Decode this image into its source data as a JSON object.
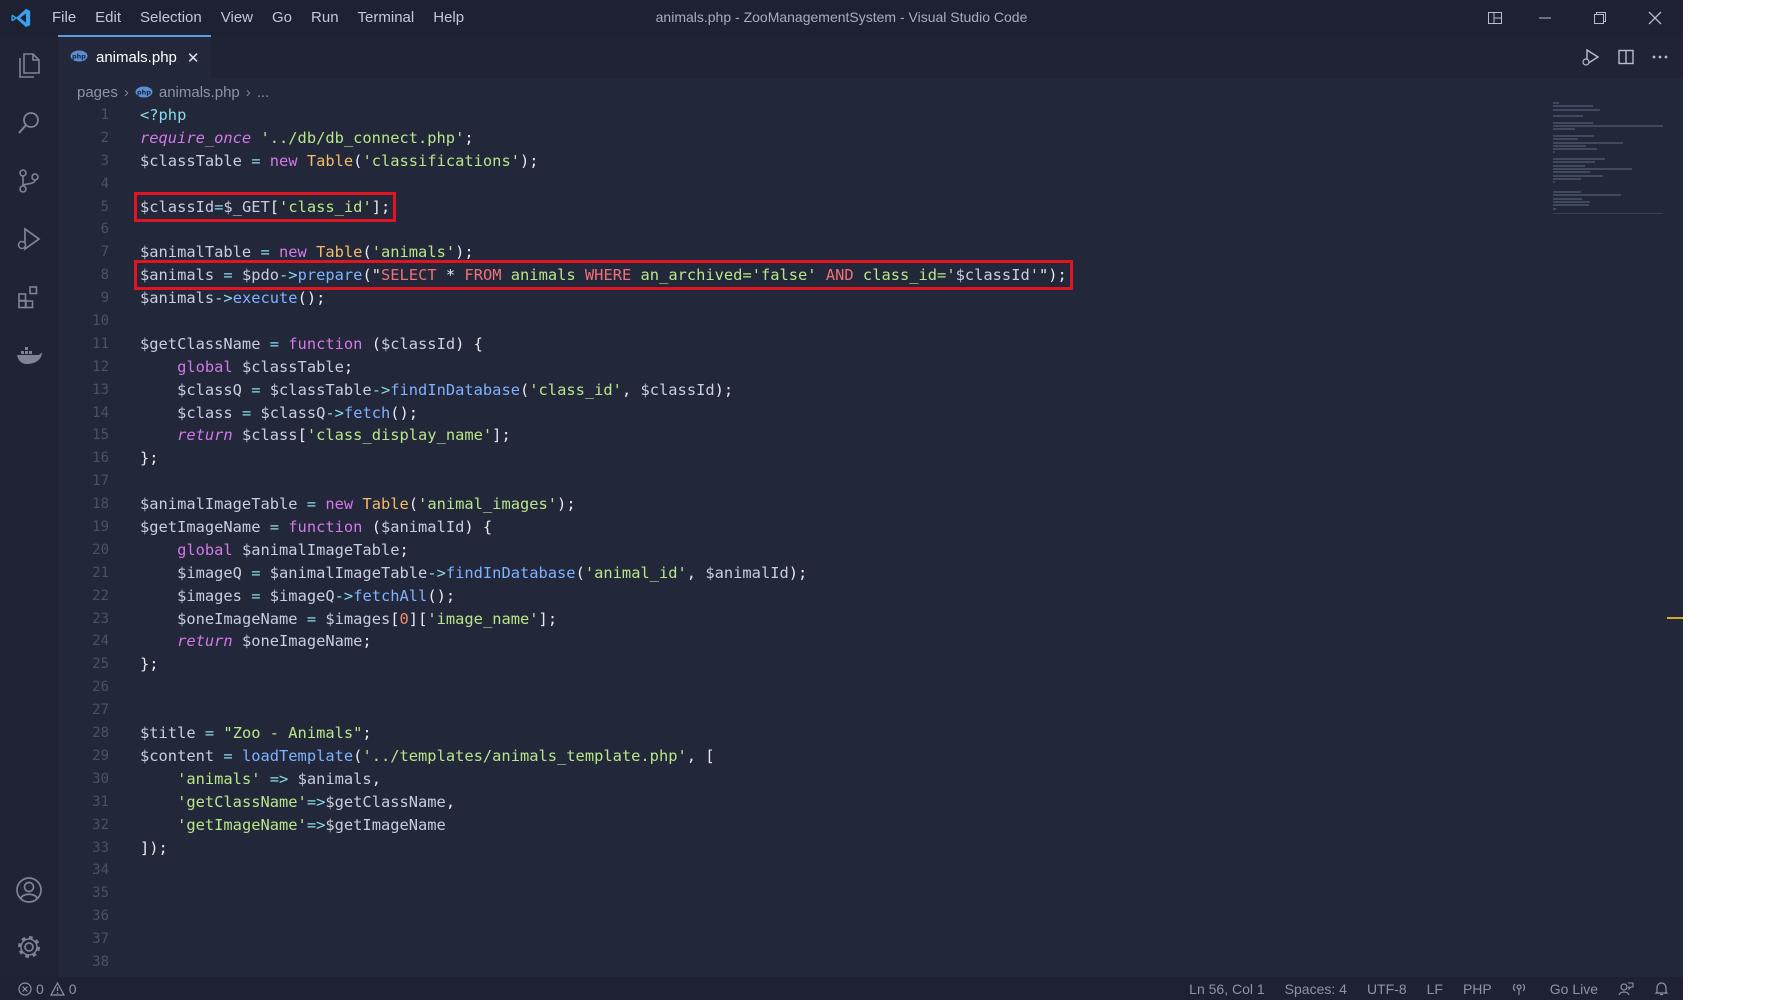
{
  "window": {
    "title": "animals.php - ZooManagementSystem - Visual Studio Code",
    "menu": [
      "File",
      "Edit",
      "Selection",
      "View",
      "Go",
      "Run",
      "Terminal",
      "Help"
    ]
  },
  "tab": {
    "label": "animals.php",
    "close": "✕"
  },
  "breadcrumb": {
    "folder": "pages",
    "file": "animals.php",
    "more": "..."
  },
  "code": {
    "line_numbers": [
      "1",
      "2",
      "3",
      "4",
      "5",
      "6",
      "7",
      "8",
      "9",
      "10",
      "11",
      "12",
      "13",
      "14",
      "15",
      "16",
      "17",
      "18",
      "19",
      "20",
      "21",
      "22",
      "23",
      "24",
      "25",
      "26",
      "27",
      "28",
      "29",
      "30",
      "31",
      "32",
      "33",
      "34",
      "35",
      "36",
      "37",
      "38"
    ],
    "lines": [
      [
        [
          "tag",
          "<?php"
        ]
      ],
      [
        [
          "kwi",
          "require_once"
        ],
        [
          "txt",
          " "
        ],
        [
          "str",
          "'../db/db_connect.php'"
        ],
        [
          "txt",
          ";"
        ]
      ],
      [
        [
          "var",
          "$classTable"
        ],
        [
          "op",
          " = "
        ],
        [
          "kw",
          "new "
        ],
        [
          "cls",
          "Table"
        ],
        [
          "txt",
          "("
        ],
        [
          "str",
          "'classifications'"
        ],
        [
          "txt",
          ");"
        ]
      ],
      [],
      [
        [
          "var",
          "$classId"
        ],
        [
          "op",
          "="
        ],
        [
          "var",
          "$_GET"
        ],
        [
          "txt",
          "["
        ],
        [
          "str",
          "'class_id'"
        ],
        [
          "txt",
          "];"
        ]
      ],
      [],
      [
        [
          "var",
          "$animalTable"
        ],
        [
          "op",
          " = "
        ],
        [
          "kw",
          "new "
        ],
        [
          "cls",
          "Table"
        ],
        [
          "txt",
          "("
        ],
        [
          "str",
          "'animals'"
        ],
        [
          "txt",
          ");"
        ]
      ],
      [
        [
          "var",
          "$animals"
        ],
        [
          "op",
          " = "
        ],
        [
          "var",
          "$pdo"
        ],
        [
          "op",
          "->"
        ],
        [
          "fn",
          "prepare"
        ],
        [
          "txt",
          "(\""
        ],
        [
          "sql",
          "SELECT"
        ],
        [
          "txt",
          " * "
        ],
        [
          "sql",
          "FROM"
        ],
        [
          "str",
          " animals "
        ],
        [
          "sql",
          "WHERE"
        ],
        [
          "str",
          " an_archived='false' "
        ],
        [
          "sql",
          "AND"
        ],
        [
          "str",
          " class_id='"
        ],
        [
          "var",
          "$classId"
        ],
        [
          "str",
          "'"
        ],
        [
          "txt",
          "\");"
        ]
      ],
      [
        [
          "var",
          "$animals"
        ],
        [
          "op",
          "->"
        ],
        [
          "fn",
          "execute"
        ],
        [
          "txt",
          "();"
        ]
      ],
      [],
      [
        [
          "var",
          "$getClassName"
        ],
        [
          "op",
          " = "
        ],
        [
          "kw",
          "function"
        ],
        [
          "txt",
          " ("
        ],
        [
          "var",
          "$classId"
        ],
        [
          "txt",
          ") {"
        ]
      ],
      [
        [
          "txt",
          "    "
        ],
        [
          "kw",
          "global "
        ],
        [
          "var",
          "$classTable"
        ],
        [
          "txt",
          ";"
        ]
      ],
      [
        [
          "txt",
          "    "
        ],
        [
          "var",
          "$classQ"
        ],
        [
          "op",
          " = "
        ],
        [
          "var",
          "$classTable"
        ],
        [
          "op",
          "->"
        ],
        [
          "fn",
          "findInDatabase"
        ],
        [
          "txt",
          "("
        ],
        [
          "str",
          "'class_id'"
        ],
        [
          "txt",
          ", "
        ],
        [
          "var",
          "$classId"
        ],
        [
          "txt",
          ");"
        ]
      ],
      [
        [
          "txt",
          "    "
        ],
        [
          "var",
          "$class"
        ],
        [
          "op",
          " = "
        ],
        [
          "var",
          "$classQ"
        ],
        [
          "op",
          "->"
        ],
        [
          "fn",
          "fetch"
        ],
        [
          "txt",
          "();"
        ]
      ],
      [
        [
          "txt",
          "    "
        ],
        [
          "kwi",
          "return "
        ],
        [
          "var",
          "$class"
        ],
        [
          "txt",
          "["
        ],
        [
          "str",
          "'class_display_name'"
        ],
        [
          "txt",
          "];"
        ]
      ],
      [
        [
          "txt",
          "};"
        ]
      ],
      [],
      [
        [
          "var",
          "$animalImageTable"
        ],
        [
          "op",
          " = "
        ],
        [
          "kw",
          "new "
        ],
        [
          "cls",
          "Table"
        ],
        [
          "txt",
          "("
        ],
        [
          "str",
          "'animal_images'"
        ],
        [
          "txt",
          ");"
        ]
      ],
      [
        [
          "var",
          "$getImageName"
        ],
        [
          "op",
          " = "
        ],
        [
          "kw",
          "function"
        ],
        [
          "txt",
          " ("
        ],
        [
          "var",
          "$animalId"
        ],
        [
          "txt",
          ") {"
        ]
      ],
      [
        [
          "txt",
          "    "
        ],
        [
          "kw",
          "global "
        ],
        [
          "var",
          "$animalImageTable"
        ],
        [
          "txt",
          ";"
        ]
      ],
      [
        [
          "txt",
          "    "
        ],
        [
          "var",
          "$imageQ"
        ],
        [
          "op",
          " = "
        ],
        [
          "var",
          "$animalImageTable"
        ],
        [
          "op",
          "->"
        ],
        [
          "fn",
          "findInDatabase"
        ],
        [
          "txt",
          "("
        ],
        [
          "str",
          "'animal_id'"
        ],
        [
          "txt",
          ", "
        ],
        [
          "var",
          "$animalId"
        ],
        [
          "txt",
          ");"
        ]
      ],
      [
        [
          "txt",
          "    "
        ],
        [
          "var",
          "$images"
        ],
        [
          "op",
          " = "
        ],
        [
          "var",
          "$imageQ"
        ],
        [
          "op",
          "->"
        ],
        [
          "fn",
          "fetchAll"
        ],
        [
          "txt",
          "();"
        ]
      ],
      [
        [
          "txt",
          "    "
        ],
        [
          "var",
          "$oneImageName"
        ],
        [
          "op",
          " = "
        ],
        [
          "var",
          "$images"
        ],
        [
          "txt",
          "["
        ],
        [
          "num",
          "0"
        ],
        [
          "txt",
          "]["
        ],
        [
          "str",
          "'image_name'"
        ],
        [
          "txt",
          "];"
        ]
      ],
      [
        [
          "txt",
          "    "
        ],
        [
          "kwi",
          "return "
        ],
        [
          "var",
          "$oneImageName"
        ],
        [
          "txt",
          ";"
        ]
      ],
      [
        [
          "txt",
          "};"
        ]
      ],
      [],
      [],
      [
        [
          "var",
          "$title"
        ],
        [
          "op",
          " = "
        ],
        [
          "str",
          "\"Zoo - Animals\""
        ],
        [
          "txt",
          ";"
        ]
      ],
      [
        [
          "var",
          "$content"
        ],
        [
          "op",
          " = "
        ],
        [
          "fn",
          "loadTemplate"
        ],
        [
          "txt",
          "("
        ],
        [
          "str",
          "'../templates/animals_template.php'"
        ],
        [
          "txt",
          ", ["
        ]
      ],
      [
        [
          "txt",
          "    "
        ],
        [
          "str",
          "'animals'"
        ],
        [
          "op",
          " => "
        ],
        [
          "var",
          "$animals"
        ],
        [
          "txt",
          ","
        ]
      ],
      [
        [
          "txt",
          "    "
        ],
        [
          "str",
          "'getClassName'"
        ],
        [
          "op",
          "=>"
        ],
        [
          "var",
          "$getClassName"
        ],
        [
          "txt",
          ","
        ]
      ],
      [
        [
          "txt",
          "    "
        ],
        [
          "str",
          "'getImageName'"
        ],
        [
          "op",
          "=>"
        ],
        [
          "var",
          "$getImageName"
        ]
      ],
      [
        [
          "txt",
          "]);"
        ]
      ],
      [],
      [],
      [],
      [],
      []
    ]
  },
  "highlights": [
    5,
    8
  ],
  "statusbar": {
    "errors": "0",
    "warnings": "0",
    "position": "Ln 56, Col 1",
    "spaces": "Spaces: 4",
    "encoding": "UTF-8",
    "eol": "LF",
    "language": "PHP",
    "golive": "Go Live"
  },
  "icons": {
    "activity": [
      "files-icon",
      "search-icon",
      "source-control-icon",
      "run-debug-icon",
      "extensions-icon",
      "docker-icon",
      "account-icon",
      "settings-gear-icon"
    ]
  }
}
